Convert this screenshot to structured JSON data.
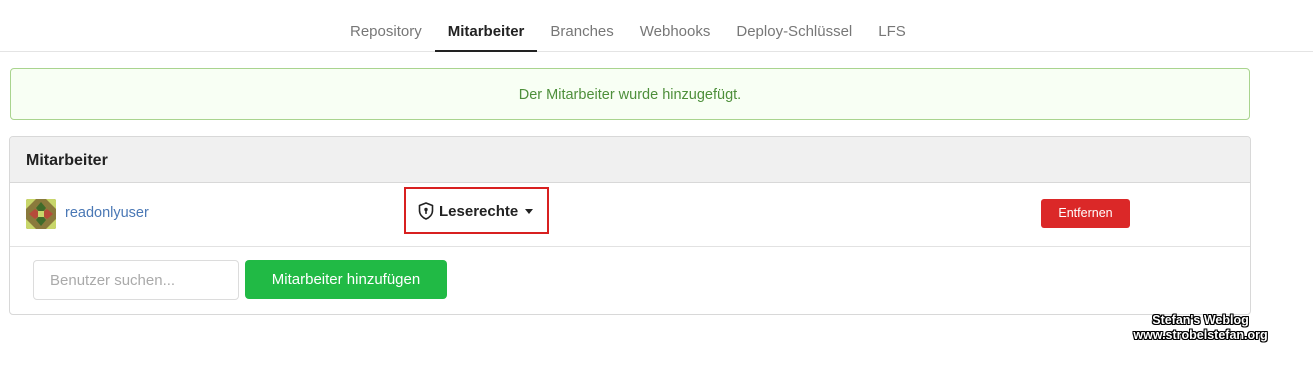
{
  "tabs": [
    {
      "label": "Repository",
      "active": false
    },
    {
      "label": "Mitarbeiter",
      "active": true
    },
    {
      "label": "Branches",
      "active": false
    },
    {
      "label": "Webhooks",
      "active": false
    },
    {
      "label": "Deploy-Schlüssel",
      "active": false
    },
    {
      "label": "LFS",
      "active": false
    }
  ],
  "flash": {
    "message": "Der Mitarbeiter wurde hinzugefügt."
  },
  "collaborators": {
    "title": "Mitarbeiter",
    "members": [
      {
        "username": "readonlyuser",
        "avatar_icon": "identicon-avatar",
        "permission": "Leserechte",
        "permission_icon": "shield-icon",
        "remove_label": "Entfernen"
      }
    ],
    "add": {
      "search_placeholder": "Benutzer suchen...",
      "search_value": "",
      "button_label": "Mitarbeiter hinzufügen"
    }
  },
  "watermark": {
    "line1": "Stefan's Weblog",
    "line2": "www.strobelstefan.org"
  },
  "colors": {
    "accent_green": "#21ba45",
    "danger_red": "#db2828",
    "link_blue": "#4a78b5",
    "highlight_border": "#d82020"
  }
}
